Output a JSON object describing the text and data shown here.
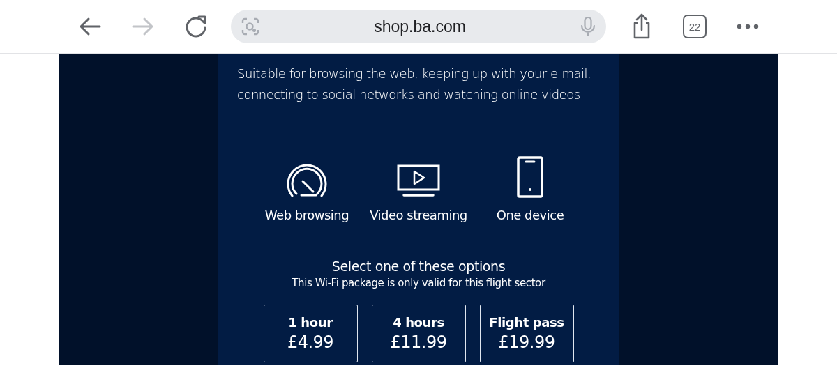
{
  "browser": {
    "back_disabled": false,
    "forward_disabled": true,
    "url": "shop.ba.com",
    "tab_count": "22"
  },
  "panel": {
    "description": "Suitable for browsing the web, keeping up with your e-mail, connecting to social networks and watching online videos",
    "features": [
      {
        "kind": "speed",
        "label": "Web browsing"
      },
      {
        "kind": "video",
        "label": "Video streaming"
      },
      {
        "kind": "device",
        "label": "One device"
      }
    ],
    "options_title": "Select one of these options",
    "options_note": "This Wi-Fi package is only valid for this flight sector",
    "options": [
      {
        "duration": "1 hour",
        "price": "£4.99"
      },
      {
        "duration": "4 hours",
        "price": "£11.99"
      },
      {
        "duration": "Flight pass",
        "price": "£19.99"
      }
    ]
  }
}
